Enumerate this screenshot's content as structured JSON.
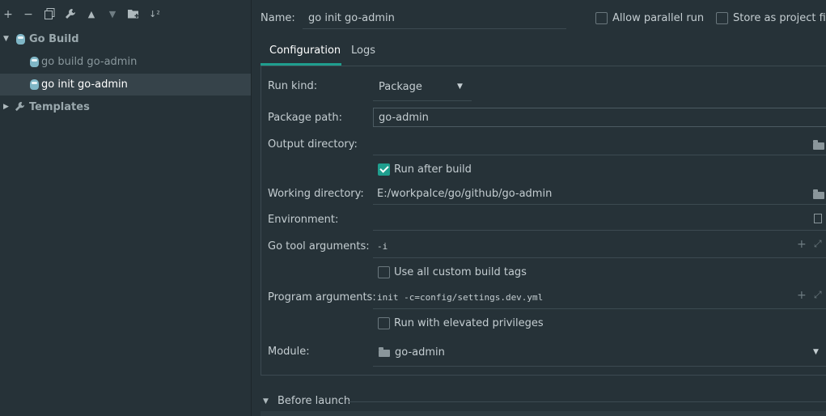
{
  "toolbar": {
    "add_icon": "+",
    "remove_icon": "−",
    "copy_icon": "copy-icon",
    "wrench_icon": "wrench-icon",
    "up_icon": "▲",
    "down_icon": "▼",
    "folder_add_icon": "folder-add-icon",
    "sort_icon": "↓²"
  },
  "tree": {
    "group": "Go Build",
    "items": [
      "go build go-admin",
      "go init go-admin"
    ],
    "templates": "Templates"
  },
  "header": {
    "name_label": "Name:",
    "name_value": "go init go-admin",
    "allow_parallel": "Allow parallel run",
    "store_as_project": "Store as project file"
  },
  "tabs": [
    "Configuration",
    "Logs"
  ],
  "form": {
    "run_kind_label": "Run kind:",
    "run_kind_value": "Package",
    "package_path_label": "Package path:",
    "package_path_value": "go-admin",
    "output_dir_label": "Output directory:",
    "run_after_build": "Run after build",
    "working_dir_label": "Working directory:",
    "working_dir_value": "E:/workpalce/go/github/go-admin",
    "environment_label": "Environment:",
    "go_tool_args_label": "Go tool arguments:",
    "go_tool_args_value": "-i",
    "custom_build_tags": "Use all custom build tags",
    "program_args_label": "Program arguments:",
    "program_args_value": "init -c=config/settings.dev.yml",
    "elevated_privileges": "Run with elevated privileges",
    "module_label": "Module:",
    "module_value": "go-admin"
  },
  "before_launch": "Before launch",
  "colors": {
    "accent": "#1f9e8e",
    "background": "#263238",
    "selection": "#36434a"
  }
}
